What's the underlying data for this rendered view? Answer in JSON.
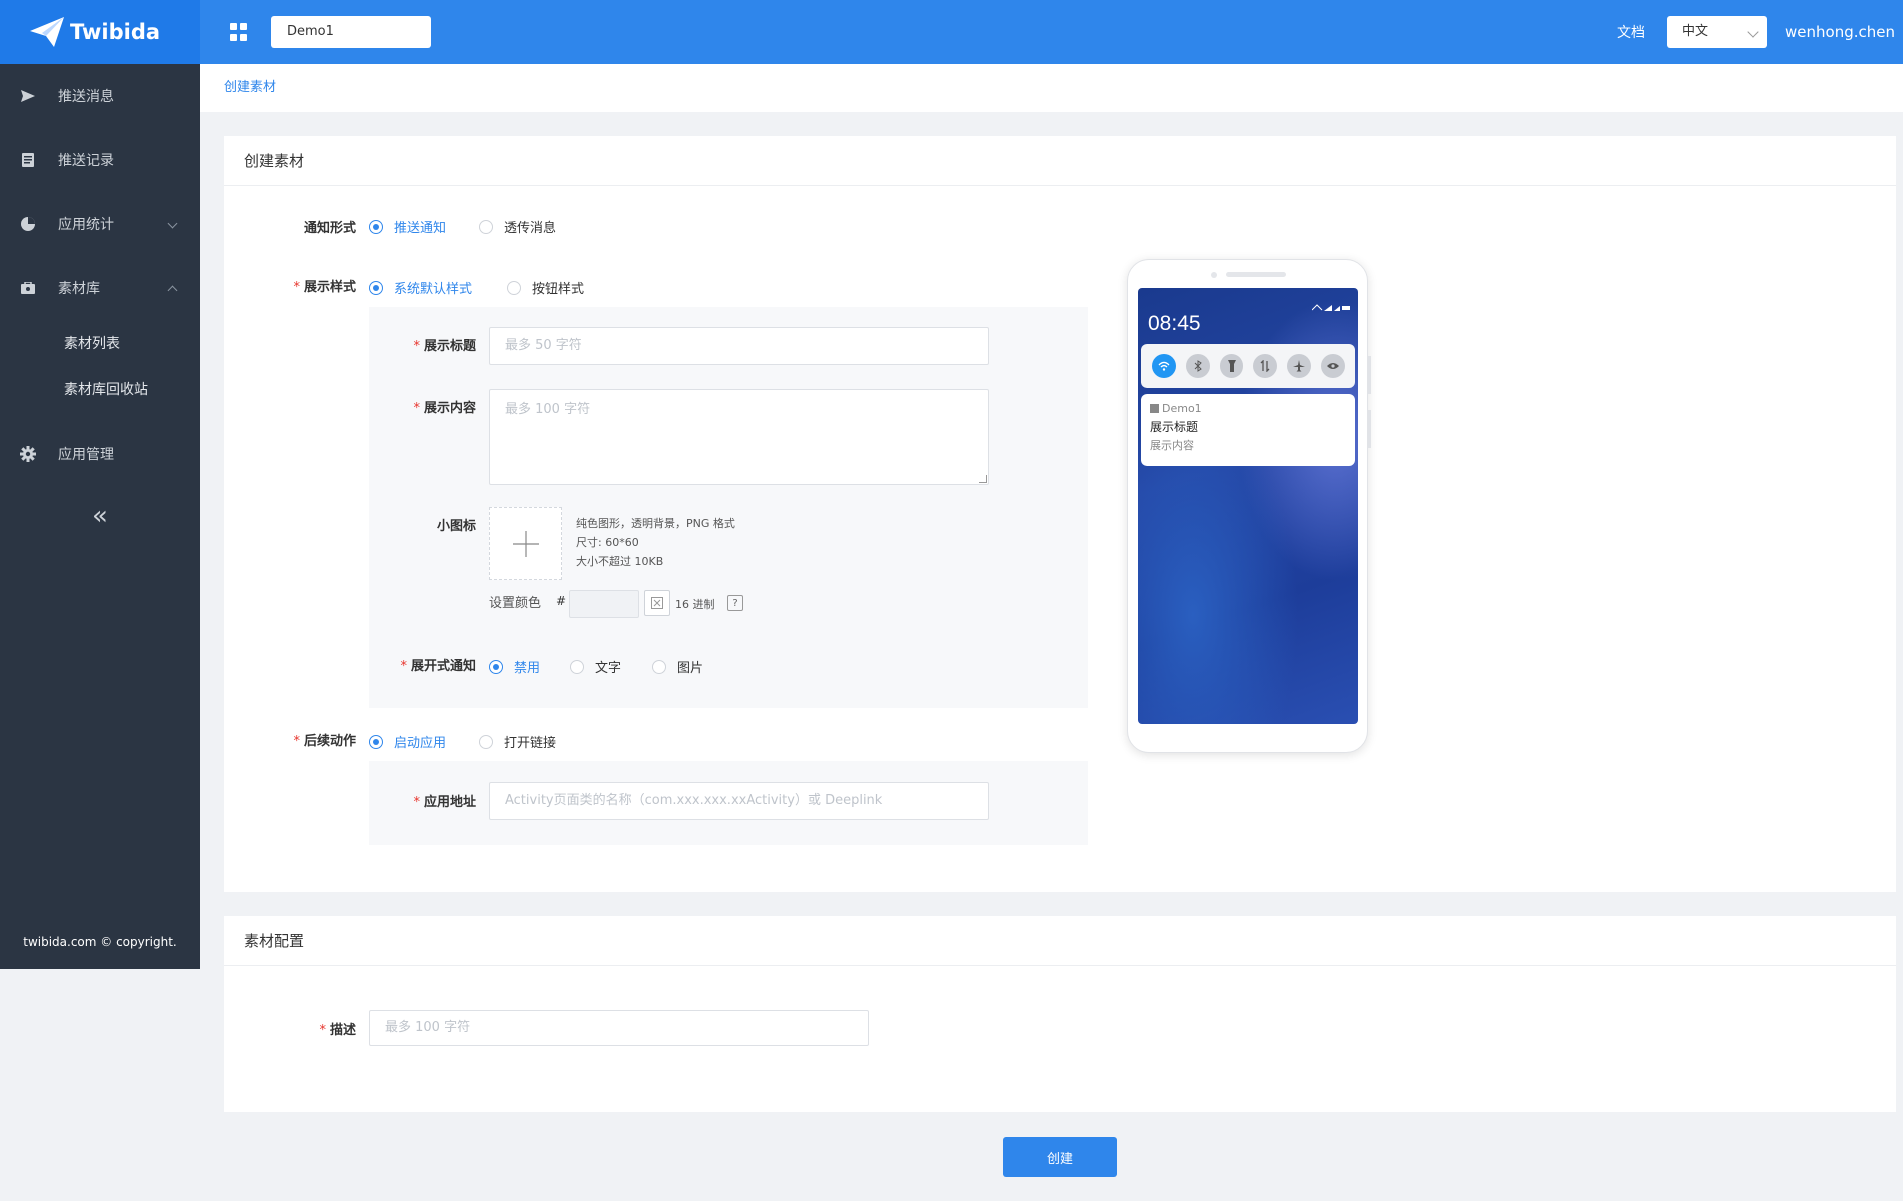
{
  "header": {
    "brand": "Twibida",
    "app_name": "Demo1",
    "docs_label": "文档",
    "language": "中文",
    "user": "wenhong.chen"
  },
  "sidebar": {
    "items": [
      {
        "label": "推送消息",
        "icon": "send-icon"
      },
      {
        "label": "推送记录",
        "icon": "document-icon"
      },
      {
        "label": "应用统计",
        "icon": "pie-chart-icon"
      },
      {
        "label": "素材库",
        "icon": "briefcase-icon"
      },
      {
        "label": "应用管理",
        "icon": "gear-icon"
      }
    ],
    "sub_items": [
      "素材列表",
      "素材库回收站"
    ],
    "collapse": "«",
    "copyright": "twibida.com © copyright."
  },
  "breadcrumb": "创建素材",
  "card1": {
    "title": "创建素材",
    "notify_type": {
      "label": "通知形式",
      "options": [
        "推送通知",
        "透传消息"
      ],
      "selected": "推送通知"
    },
    "display_style": {
      "label": "展示样式",
      "options": [
        "系统默认样式",
        "按钮样式"
      ],
      "selected": "系统默认样式"
    },
    "display_title": {
      "label": "展示标题",
      "placeholder": "最多 50 字符"
    },
    "display_content": {
      "label": "展示内容",
      "placeholder": "最多 100 字符"
    },
    "small_icon": {
      "label": "小图标",
      "hints": [
        "纯色图形，透明背景，PNG 格式",
        "尺寸: 60*60",
        "大小不超过 10KB"
      ],
      "color_label": "设置颜色",
      "hash": "#",
      "hex_label": "16 进制",
      "help": "?"
    },
    "expand": {
      "label": "展开式通知",
      "options": [
        "禁用",
        "文字",
        "图片"
      ],
      "selected": "禁用"
    },
    "action": {
      "label": "后续动作",
      "options": [
        "启动应用",
        "打开链接"
      ],
      "selected": "启动应用"
    },
    "app_address": {
      "label": "应用地址",
      "placeholder": "Activity页面类的名称（com.xxx.xxx.xxActivity）或 Deeplink"
    }
  },
  "preview": {
    "time": "08:45",
    "app": "Demo1",
    "title": "展示标题",
    "content": "展示内容",
    "quick_settings": [
      "wifi-icon",
      "bluetooth-icon",
      "flashlight-icon",
      "data-icon",
      "airplane-icon",
      "eye-icon"
    ]
  },
  "card2": {
    "title": "素材配置",
    "desc": {
      "label": "描述",
      "placeholder": "最多 100 字符"
    }
  },
  "create_button": "创建",
  "colors": {
    "primary": "#2f86eb",
    "sidebar": "#2b3543",
    "required": "#e7332b"
  }
}
